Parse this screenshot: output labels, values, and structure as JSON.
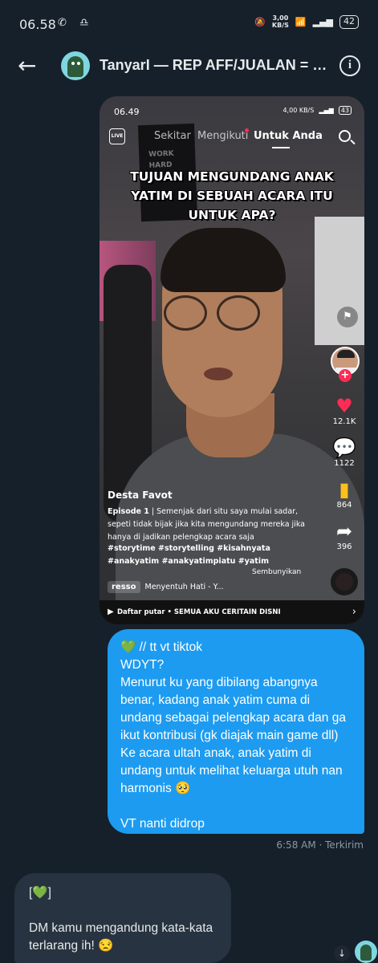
{
  "status_bar": {
    "time": "06.58",
    "left_icons": "✆ ♎",
    "speed": "3,00\nKB/S",
    "battery": "42"
  },
  "header": {
    "back_icon": "←",
    "title": "TanyarI — REP AFF/JUALAN = BL...",
    "info_icon": "i"
  },
  "video": {
    "status_time": "06.49",
    "status_speed": "4,00 KB/S",
    "battery": "43",
    "live_label": "LIVE",
    "tabs": [
      "Sekitar",
      "Mengikuti",
      "Untuk Anda"
    ],
    "poster_text": "WORK\nHARD",
    "caption": "TUJUAN MENGUNDANG ANAK YATIM DI SEBUAH ACARA ITU UNTUK APA?",
    "likes": "12.1K",
    "comments": "1122",
    "bookmarks": "864",
    "shares": "396",
    "username": "Desta Favot",
    "episode": "Episode 1",
    "description": "Semenjak dari situ saya mulai sadar, sepeti tidak bijak jika kita mengundang mereka jika hanya di jadikan pelengkap acara saja",
    "hashtags": "#storytime #storytelling #kisahnyata #anakyatim #anakyatimpiatu #yatim",
    "hide_label": "Sembunyikan",
    "music_app": "resso",
    "music_title": "Menyentuh Hati - Y...",
    "playlist": "Daftar putar • SEMUA AKU CERITAIN DISNI"
  },
  "outgoing_message": {
    "text": "💚 // tt vt tiktok\nWDYT?\nMenurut ku yang dibilang abangnya benar, kadang anak yatim cuma di undang sebagai pelengkap acara dan ga ikut kontribusi (gk diajak main game dll)\nKe acara ultah anak, anak yatim di undang untuk melihat keluarga utuh nan harmonis 🥺\n\nVT nanti didrop",
    "meta": "6:58 AM · Terkirim"
  },
  "incoming_message": {
    "text": "[💚]\n\nDM kamu mengandung kata-kata terlarang ih! 😒"
  },
  "colors": {
    "background": "#15202b",
    "outgoing_bubble": "#1d9bf0",
    "incoming_bubble": "#273340",
    "like": "#fe2c55"
  }
}
